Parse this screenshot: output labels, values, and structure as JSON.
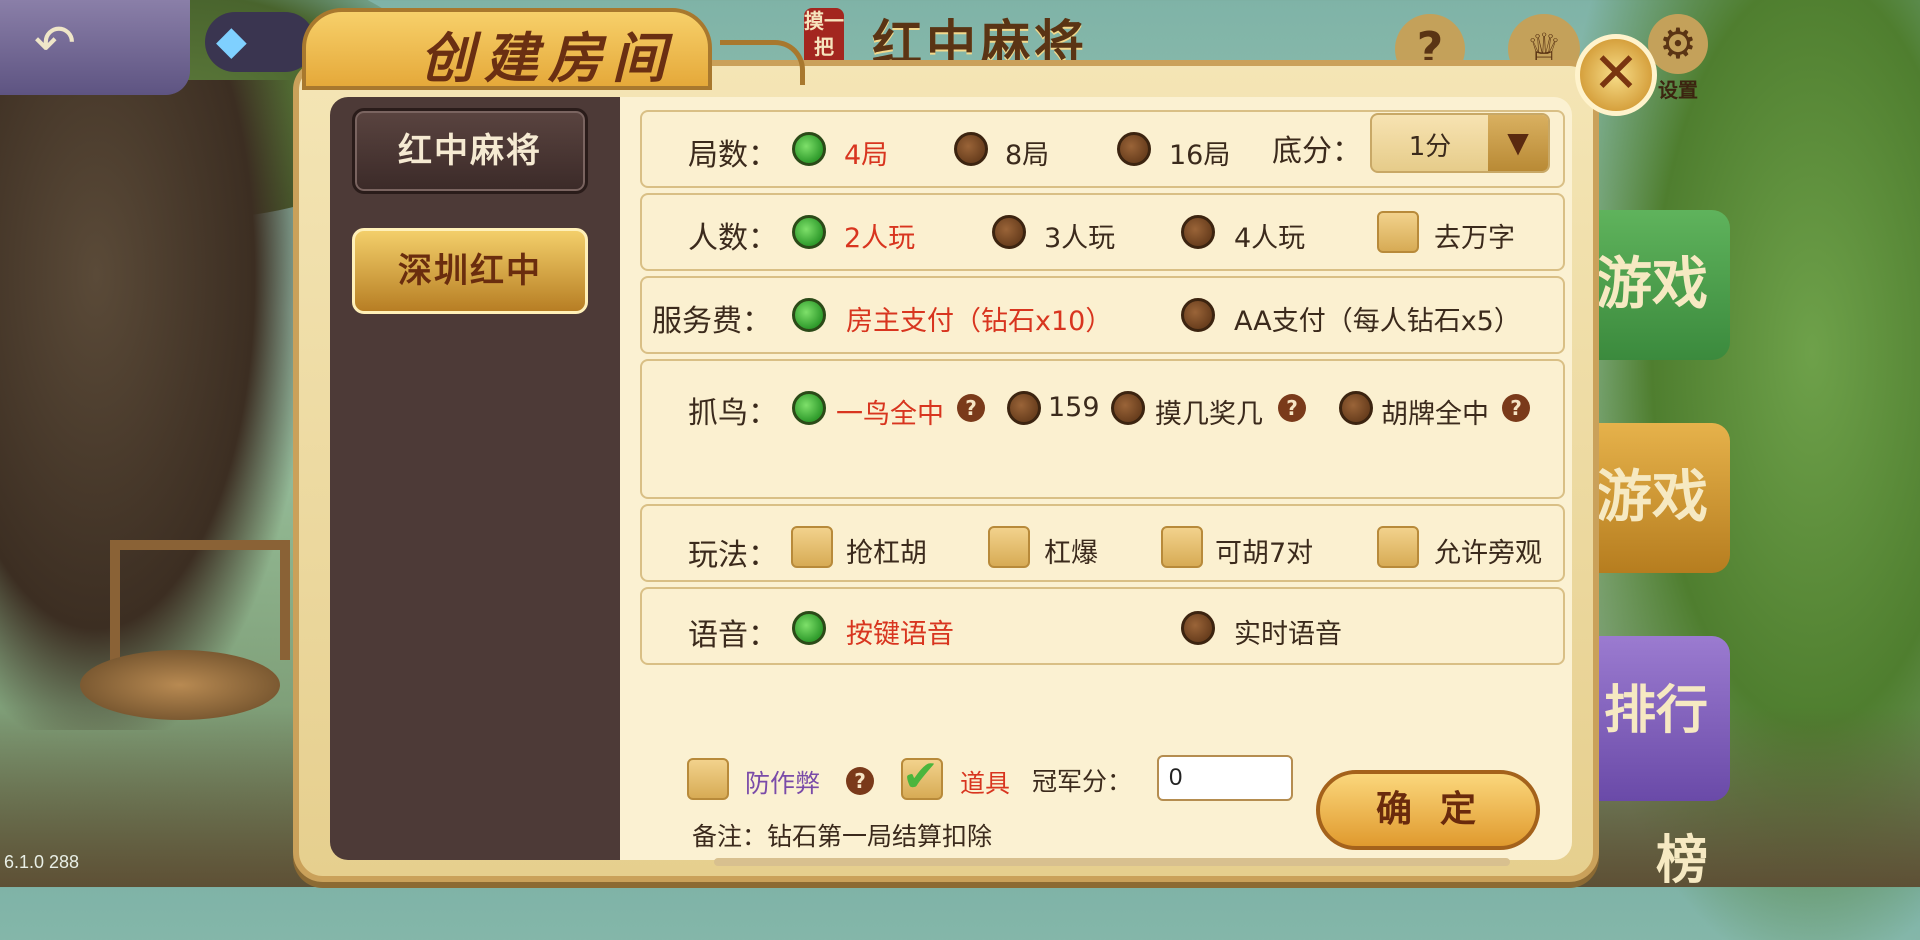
{
  "top_bar": {
    "title": "红中麻将",
    "badge": "摸一把",
    "settings_label": "设置"
  },
  "dialog": {
    "title": "创建房间"
  },
  "game_tabs": [
    {
      "label": "红中麻将",
      "selected": false
    },
    {
      "label": "深圳红中",
      "selected": true
    }
  ],
  "rounds": {
    "label": "局数：",
    "options": [
      "4局",
      "8局",
      "16局"
    ],
    "selected": "4局"
  },
  "base_score": {
    "label": "底分：",
    "value": "1分"
  },
  "players": {
    "label": "人数：",
    "options": [
      "2人玩",
      "3人玩",
      "4人玩"
    ],
    "selected": "2人玩",
    "remove_wan_label": "去万字",
    "remove_wan_checked": false
  },
  "service_fee": {
    "label": "服务费：",
    "options": [
      "房主支付（钻石x10）",
      "AA支付（每人钻石x5）"
    ],
    "selected": "房主支付（钻石x10）"
  },
  "bird": {
    "label": "抓鸟：",
    "options": [
      "一鸟全中",
      "159",
      "摸几奖几",
      "胡牌全中"
    ],
    "selected": "一鸟全中"
  },
  "gameplay": {
    "label": "玩法：",
    "options": [
      {
        "label": "抢杠胡",
        "checked": false
      },
      {
        "label": "杠爆",
        "checked": false
      },
      {
        "label": "可胡7对",
        "checked": false
      },
      {
        "label": "允许旁观",
        "checked": false
      }
    ]
  },
  "voice": {
    "label": "语音：",
    "options": [
      "按键语音",
      "实时语音"
    ],
    "selected": "按键语音"
  },
  "bottom": {
    "anti_cheat_label": "防作弊",
    "anti_cheat_checked": false,
    "props_label": "道具",
    "props_checked": true,
    "champion_label": "冠军分：",
    "champion_value": "0",
    "confirm_label": "确定",
    "note": "备注：钻石第一局结算扣除"
  },
  "lobby_buttons": [
    "游戏",
    "游戏",
    "排行榜"
  ],
  "version": "6.1.0 288",
  "colors": {
    "selected_text": "#d8351f",
    "radio_on": "#2f9b2c",
    "panel_dark": "#4d3a37",
    "panel_light": "#fbf1d2"
  }
}
